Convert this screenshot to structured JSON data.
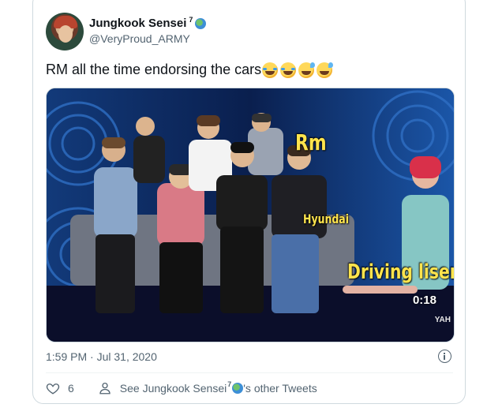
{
  "tweet": {
    "display_name": "Jungkook Sensei",
    "name_superscript": "7",
    "handle": "@VeryProud_ARMY",
    "text": "RM all the time endorsing the cars",
    "timestamp": "1:59 PM · Jul 31, 2020",
    "like_count": "6",
    "profile_link_prefix": "See Jungkook Sensei",
    "profile_link_suffix": "'s other Tweets"
  },
  "media": {
    "caption_rm": "Rm",
    "caption_hyundai": "Hyundai",
    "caption_license": "Driving lisence",
    "video_time": "0:18",
    "watermark": "YAH"
  },
  "icons": {
    "verified_style": "globe-emoji",
    "like": "heart-icon",
    "profile": "person-icon",
    "info": "info-icon"
  },
  "colors": {
    "text_primary": "#0f1419",
    "text_secondary": "#536471",
    "border": "#cfd9de",
    "caption_yellow": "#ffe44d"
  }
}
